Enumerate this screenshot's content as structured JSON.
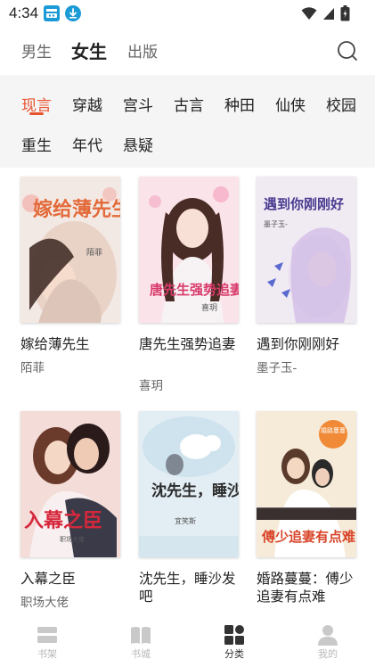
{
  "status_bar": {
    "time": "4:34",
    "icons": [
      "notification-app-icon",
      "download-icon",
      "wifi-icon",
      "cell-signal-icon",
      "battery-icon"
    ]
  },
  "header": {
    "tabs": [
      {
        "label": "男生",
        "active": false
      },
      {
        "label": "女生",
        "active": true
      },
      {
        "label": "出版",
        "active": false
      }
    ],
    "search_icon": "search-icon"
  },
  "categories": {
    "items": [
      "现言",
      "穿越",
      "宫斗",
      "古言",
      "种田",
      "仙侠",
      "校园",
      "重生",
      "年代",
      "悬疑"
    ],
    "active": "现言",
    "accent_color": "#e8532f"
  },
  "books": [
    {
      "title": "嫁给薄先生",
      "author": "陌菲",
      "cover": {
        "title_text": "嫁给薄先生",
        "author_text": "陌菲",
        "bg": "#f3e9e4",
        "accent": "#e36a3a"
      }
    },
    {
      "title": "唐先生强势追妻",
      "author": "喜玥",
      "cover": {
        "title_text": "唐先生强势追妻",
        "author_text": "喜玥",
        "bg": "#fbe3ea",
        "accent": "#d83a6a"
      }
    },
    {
      "title": "遇到你刚刚好",
      "author": "墨子玉-",
      "cover": {
        "title_text": "遇到你刚刚好",
        "author_text": "墨子玉-",
        "bg": "#f0eaf3",
        "accent": "#6a5ab0"
      }
    },
    {
      "title": "入幕之臣",
      "author": "职场大佬",
      "cover": {
        "title_text": "入幕之臣",
        "author_text": "职场大佬",
        "bg": "#f4dcd8",
        "accent": "#d6283c"
      }
    },
    {
      "title": "沈先生，睡沙发吧",
      "author": "",
      "cover": {
        "title_text": "沈先生，睡沙发吧",
        "author_text": "宜笑斯",
        "bg": "#e3eef4",
        "accent": "#2a2a2a"
      }
    },
    {
      "title": "婚路蔓蔓：傅少追妻有点难",
      "author": "",
      "cover": {
        "title_text": "傅少追妻有点难",
        "author_text": "婚路蔓蔓",
        "bg": "#f6ead8",
        "accent": "#d8452a"
      }
    }
  ],
  "bottom_nav": {
    "items": [
      {
        "label": "书架",
        "icon": "bookshelf-icon",
        "active": false
      },
      {
        "label": "书城",
        "icon": "open-book-icon",
        "active": false
      },
      {
        "label": "分类",
        "icon": "category-grid-icon",
        "active": true
      },
      {
        "label": "我的",
        "icon": "profile-icon",
        "active": false
      }
    ]
  }
}
